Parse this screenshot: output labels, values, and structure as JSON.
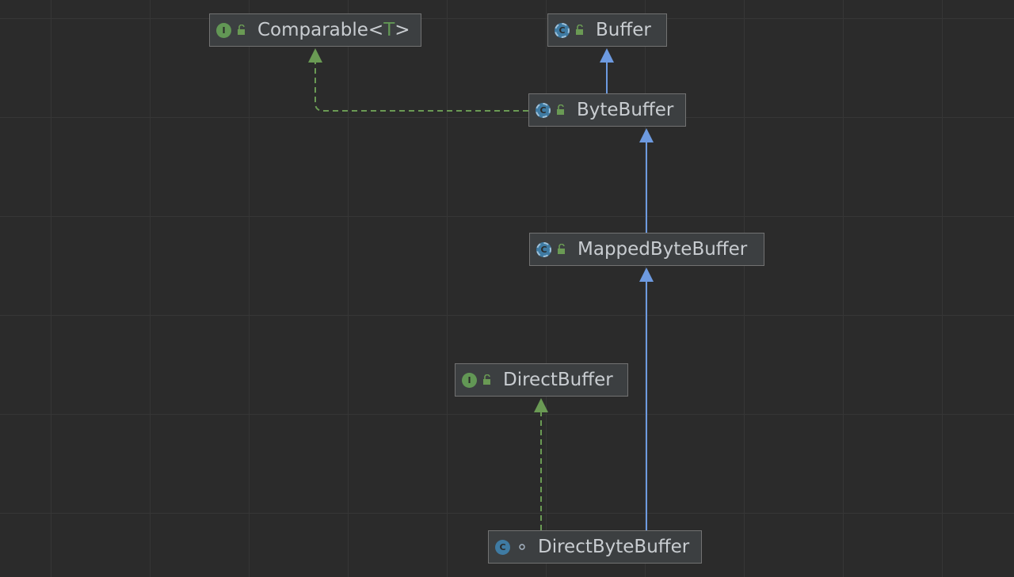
{
  "nodes": {
    "comparable": {
      "name": "Comparable",
      "lt": "<",
      "param": "T",
      "gt": ">",
      "kind": "interface",
      "kind_letter": "I",
      "visibility": "public"
    },
    "buffer": {
      "name": "Buffer",
      "kind": "abstract-class",
      "kind_letter": "C",
      "visibility": "public"
    },
    "bytebuffer": {
      "name": "ByteBuffer",
      "kind": "abstract-class",
      "kind_letter": "C",
      "visibility": "public"
    },
    "mappedbytebuffer": {
      "name": "MappedByteBuffer",
      "kind": "abstract-class",
      "kind_letter": "C",
      "visibility": "public"
    },
    "directbuffer": {
      "name": "DirectBuffer",
      "kind": "interface",
      "kind_letter": "I",
      "visibility": "public"
    },
    "directbytebuffer": {
      "name": "DirectByteBuffer",
      "kind": "class",
      "kind_letter": "C",
      "visibility": "package-private"
    }
  },
  "edges": [
    {
      "from": "bytebuffer",
      "to": "buffer",
      "type": "extends"
    },
    {
      "from": "bytebuffer",
      "to": "comparable",
      "type": "implements"
    },
    {
      "from": "mappedbytebuffer",
      "to": "bytebuffer",
      "type": "extends"
    },
    {
      "from": "directbytebuffer",
      "to": "mappedbytebuffer",
      "type": "extends"
    },
    {
      "from": "directbytebuffer",
      "to": "directbuffer",
      "type": "implements"
    }
  ],
  "colors": {
    "background": "#2b2b2b",
    "grid": "#363636",
    "node_fill": "#3c3f41",
    "node_border": "#727272",
    "node_text": "#c9cdd1",
    "extends_line": "#6d9ae0",
    "implements_line": "#6a9a54",
    "interface_icon": "#629755",
    "class_icon": "#3f7ba3"
  }
}
